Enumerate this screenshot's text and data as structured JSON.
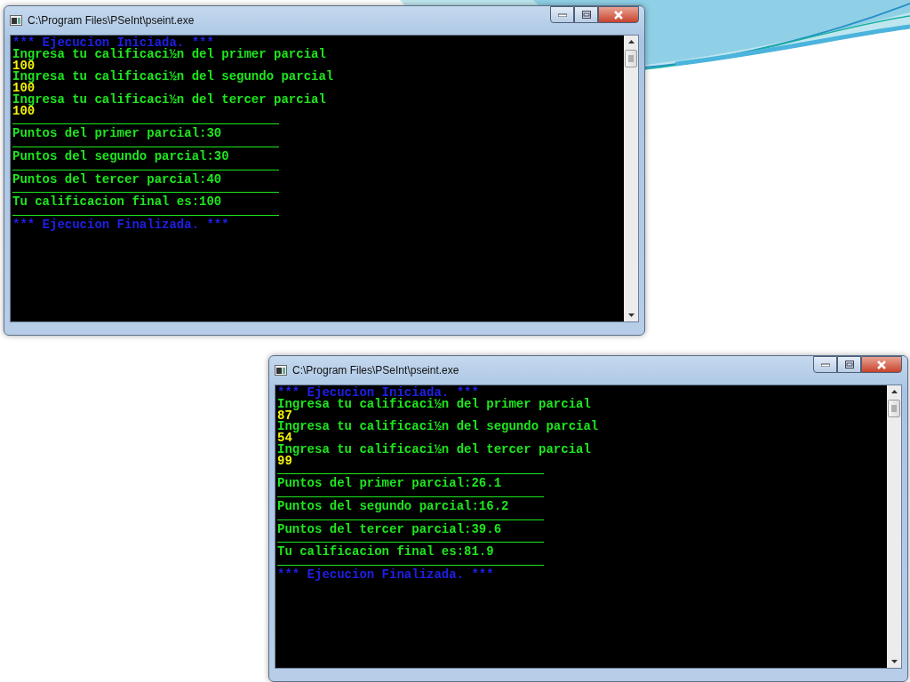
{
  "windows": [
    {
      "title": "C:\\Program Files\\PSeInt\\pseint.exe",
      "lines": [
        {
          "kind": "banner",
          "text": "*** Ejecucion Iniciada. ***"
        },
        {
          "kind": "prompt",
          "text": "Ingresa tu calificaci½n del primer parcial"
        },
        {
          "kind": "input",
          "text": "100"
        },
        {
          "kind": "prompt",
          "text": "Ingresa tu calificaci½n del segundo parcial"
        },
        {
          "kind": "input",
          "text": "100"
        },
        {
          "kind": "prompt",
          "text": "Ingresa tu calificaci½n del tercer parcial"
        },
        {
          "kind": "input",
          "text": "100"
        },
        {
          "kind": "rule"
        },
        {
          "kind": "result",
          "text": "Puntos del primer parcial:30"
        },
        {
          "kind": "rule"
        },
        {
          "kind": "result",
          "text": "Puntos del segundo parcial:30"
        },
        {
          "kind": "rule"
        },
        {
          "kind": "result",
          "text": "Puntos del tercer parcial:40"
        },
        {
          "kind": "rule"
        },
        {
          "kind": "result",
          "text": "Tu calificacion final es:100"
        },
        {
          "kind": "rule"
        },
        {
          "kind": "banner",
          "text": "*** Ejecucion Finalizada. ***"
        }
      ]
    },
    {
      "title": "C:\\Program Files\\PSeInt\\pseint.exe",
      "lines": [
        {
          "kind": "banner",
          "text": "*** Ejecucion Iniciada. ***"
        },
        {
          "kind": "prompt",
          "text": "Ingresa tu calificaci½n del primer parcial"
        },
        {
          "kind": "input",
          "text": "87"
        },
        {
          "kind": "prompt",
          "text": "Ingresa tu calificaci½n del segundo parcial"
        },
        {
          "kind": "input",
          "text": "54"
        },
        {
          "kind": "prompt",
          "text": "Ingresa tu calificaci½n del tercer parcial"
        },
        {
          "kind": "input",
          "text": "99"
        },
        {
          "kind": "rule"
        },
        {
          "kind": "result",
          "text": "Puntos del primer parcial:26.1"
        },
        {
          "kind": "rule"
        },
        {
          "kind": "result",
          "text": "Puntos del segundo parcial:16.2"
        },
        {
          "kind": "rule"
        },
        {
          "kind": "result",
          "text": "Puntos del tercer parcial:39.6"
        },
        {
          "kind": "rule"
        },
        {
          "kind": "result",
          "text": "Tu calificacion final es:81.9"
        },
        {
          "kind": "rule"
        },
        {
          "kind": "banner",
          "text": "*** Ejecucion Finalizada. ***"
        }
      ]
    }
  ]
}
